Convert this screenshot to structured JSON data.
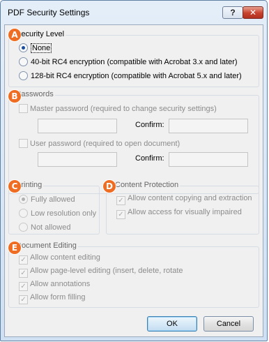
{
  "window": {
    "title": "PDF Security Settings",
    "help_label": "?",
    "close_label": "✕"
  },
  "badges": {
    "a": "A",
    "b": "B",
    "c": "C",
    "d": "D",
    "e": "E"
  },
  "security_level": {
    "legend": "Security Level",
    "options": [
      {
        "label": "None",
        "selected": true
      },
      {
        "label": "40-bit RC4 encryption (compatible with Acrobat 3.x and later)",
        "selected": false
      },
      {
        "label": "128-bit RC4 encryption (compatible with Acrobat 5.x and later)",
        "selected": false
      }
    ]
  },
  "passwords": {
    "legend": "Passwords",
    "master_label": "Master password  (required to change security settings)",
    "master_confirm_label": "Confirm:",
    "user_label": "User password  (required to open document)",
    "user_confirm_label": "Confirm:",
    "master_value": "",
    "master_confirm_value": "",
    "user_value": "",
    "user_confirm_value": ""
  },
  "printing": {
    "legend": "Printing",
    "options": [
      {
        "label": "Fully allowed",
        "selected": true
      },
      {
        "label": "Low resolution only",
        "selected": false
      },
      {
        "label": "Not allowed",
        "selected": false
      }
    ]
  },
  "content_protection": {
    "legend": "Content Protection",
    "options": [
      {
        "label": "Allow content copying and extraction",
        "checked": true
      },
      {
        "label": "Allow access for visually impaired",
        "checked": true
      }
    ]
  },
  "document_editing": {
    "legend": "Document Editing",
    "options": [
      {
        "label": "Allow content editing",
        "checked": true
      },
      {
        "label": "Allow page-level editing (insert, delete, rotate",
        "checked": true
      },
      {
        "label": "Allow annotations",
        "checked": true
      },
      {
        "label": "Allow form filling",
        "checked": true
      }
    ]
  },
  "buttons": {
    "ok": "OK",
    "cancel": "Cancel"
  },
  "colors": {
    "badge": "#ef6c23",
    "titlebar": "#dbe8f6",
    "close": "#c7412d"
  }
}
